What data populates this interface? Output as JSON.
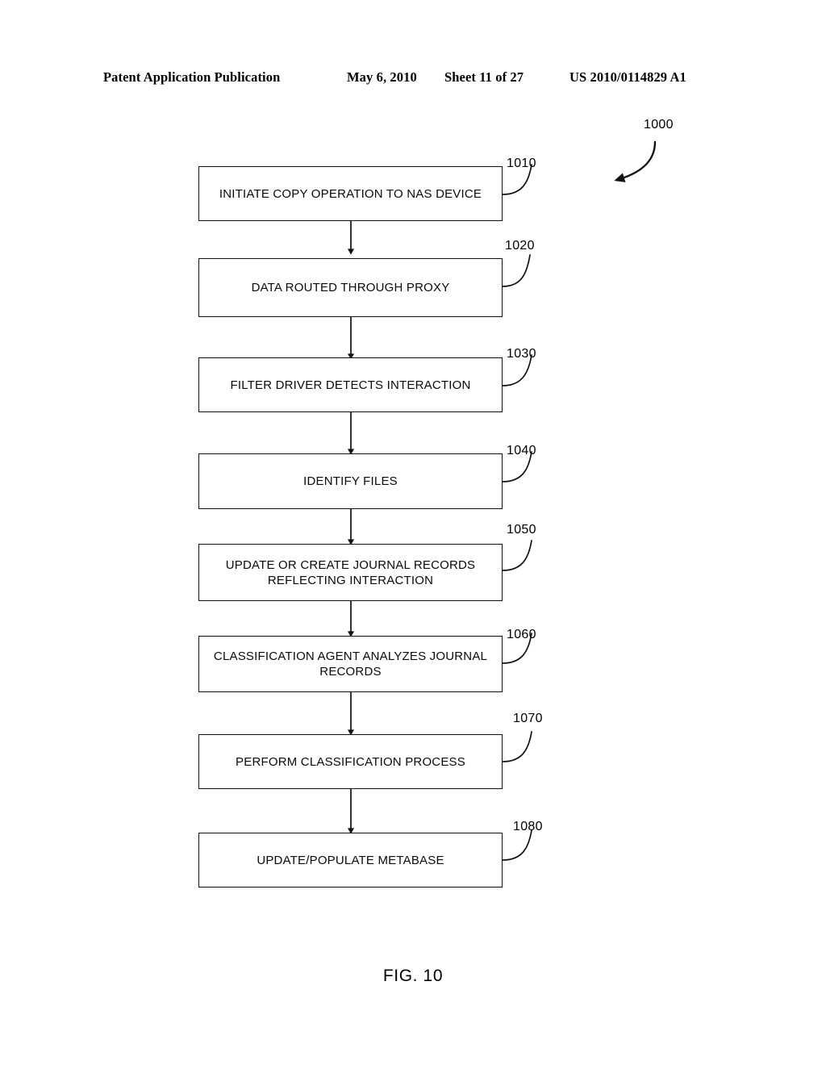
{
  "header": {
    "publication": "Patent Application Publication",
    "date": "May 6, 2010",
    "sheet": "Sheet 11 of 27",
    "number": "US 2010/0114829 A1"
  },
  "figure": {
    "caption": "FIG. 10",
    "overall_ref": "1000",
    "steps": [
      {
        "ref": "1010",
        "line1": "INITIATE COPY OPERATION TO NAS DEVICE",
        "line2": ""
      },
      {
        "ref": "1020",
        "line1": "DATA ROUTED THROUGH PROXY",
        "line2": ""
      },
      {
        "ref": "1030",
        "line1": "FILTER DRIVER DETECTS INTERACTION",
        "line2": ""
      },
      {
        "ref": "1040",
        "line1": "IDENTIFY FILES",
        "line2": ""
      },
      {
        "ref": "1050",
        "line1": "UPDATE OR CREATE JOURNAL RECORDS",
        "line2": "REFLECTING INTERACTION"
      },
      {
        "ref": "1060",
        "line1": "CLASSIFICATION AGENT ANALYZES JOURNAL",
        "line2": "RECORDS"
      },
      {
        "ref": "1070",
        "line1": "PERFORM CLASSIFICATION PROCESS",
        "line2": ""
      },
      {
        "ref": "1080",
        "line1": "UPDATE/POPULATE METABASE",
        "line2": ""
      }
    ]
  },
  "colors": {
    "ink": "#000000",
    "page": "#ffffff"
  }
}
